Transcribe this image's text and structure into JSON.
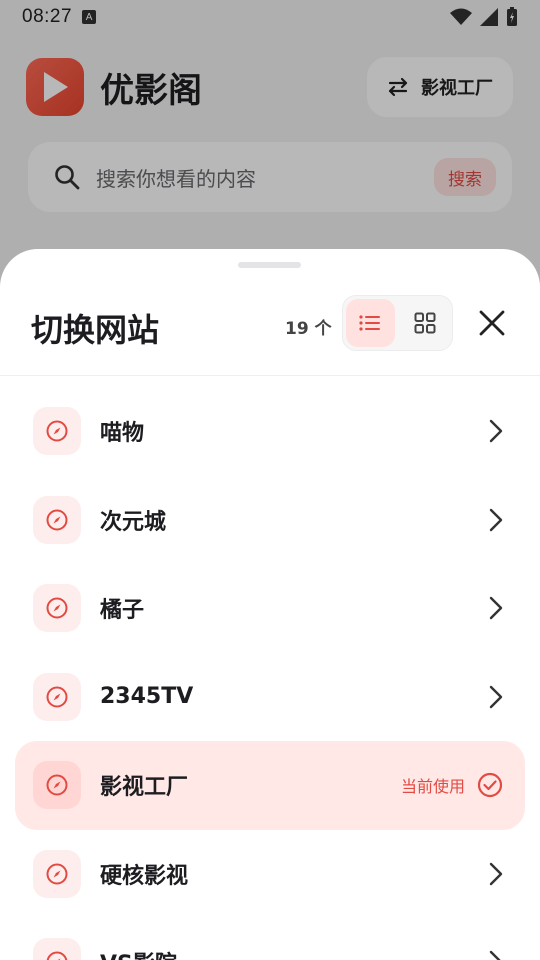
{
  "status": {
    "time": "08:27",
    "notif_badge": "A"
  },
  "app": {
    "title": "优影阁",
    "switch_label": "影视工厂"
  },
  "search": {
    "placeholder": "搜索你想看的内容",
    "button": "搜索"
  },
  "sheet": {
    "title": "切换网站",
    "count": "19 个",
    "view_mode": "list",
    "current_label": "当前使用",
    "sites": [
      {
        "name": "喵物",
        "current": false
      },
      {
        "name": "次元城",
        "current": false
      },
      {
        "name": "橘子",
        "current": false
      },
      {
        "name": "2345TV",
        "current": false
      },
      {
        "name": "影视工厂",
        "current": true
      },
      {
        "name": "硬核影视",
        "current": false
      },
      {
        "name": "VS影院",
        "current": false
      }
    ]
  },
  "colors": {
    "accent": "#e24b43",
    "accent_light": "#ffe8e6",
    "logo": "#e8452f"
  },
  "icons": [
    "search-icon",
    "swap-icon",
    "list-view-icon",
    "grid-view-icon",
    "close-icon",
    "compass-icon",
    "chevron-right-icon",
    "check-circle-icon",
    "wifi-icon",
    "signal-icon",
    "battery-icon"
  ]
}
